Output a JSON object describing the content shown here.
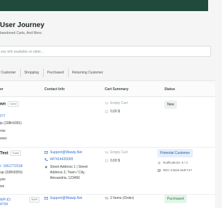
{
  "header": {
    "title": "User Journey",
    "subtitle": "bandoned Carts, And More."
  },
  "search": {
    "placeholder": "any info available on table..."
  },
  "tabs": [
    "al Customer",
    "Shopping",
    "Purchased",
    "Returning Customer"
  ],
  "table": {
    "headers": {
      "customer": "er",
      "contact": "Contact Info",
      "cart": "Cart Summary",
      "status": "Status"
    },
    "rows": [
      {
        "name": "wn",
        "badge": "Guest",
        "lines": [
          "ITT",
          "ip  (338h9355)",
          "vas",
          "wws"
        ],
        "contact": [],
        "cart": [
          "Empty Cart",
          "0,00 $"
        ],
        "status": "New",
        "extra": []
      },
      {
        "name": "Test",
        "badge": "Guest",
        "lines": [
          "r: 1561772318",
          "up  (338h9355)",
          "yas",
          "ws"
        ],
        "contact": [
          "Support@Wawip.Net",
          "447414420000",
          "Street Address 1 | Street",
          "Address 2, Town / City,",
          "Alexandria, 123456"
        ],
        "cart": [
          "Empty Cart",
          "0,00 $"
        ],
        "status": "Potential Customer",
        "extra": [
          "Notifications: 5 / 2",
          "REC-44834-6NFYX7"
        ]
      },
      {
        "name": "WP-ID:",
        "badge": "ShHP",
        "lines": [
          "4734"
        ],
        "contact": [
          "Support@Wawip.Net"
        ],
        "cart": [
          "2 Items (Order)"
        ],
        "status": "Purchased",
        "extra": []
      }
    ]
  }
}
